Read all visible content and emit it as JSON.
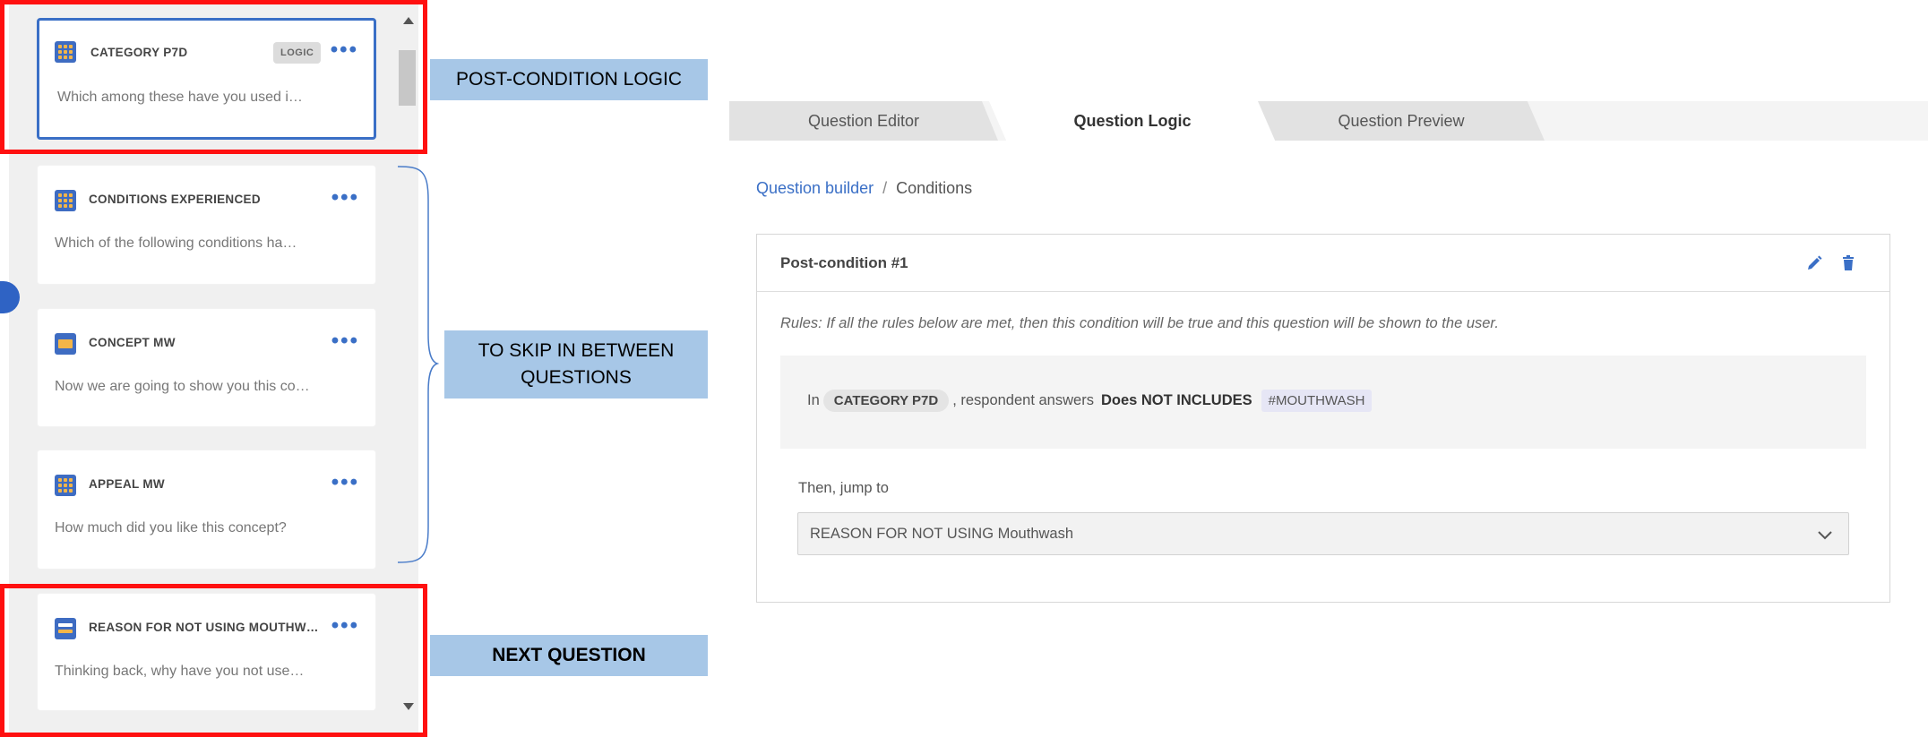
{
  "questions": [
    {
      "title": "CATEGORY P7D",
      "badge": "LOGIC",
      "text": "Which among these have you used i…",
      "icon": "grid-question-icon",
      "selected": true
    },
    {
      "title": "CONDITIONS EXPERIENCED",
      "text": "Which of the following conditions ha…",
      "icon": "grid-question-icon"
    },
    {
      "title": "CONCEPT MW",
      "text": "Now we are going to show you this co…",
      "icon": "media-question-icon"
    },
    {
      "title": "APPEAL MW",
      "text": "How much did you like this concept?",
      "icon": "grid-question-icon"
    },
    {
      "title": "REASON FOR NOT USING MOUTHW…",
      "text": "Thinking back, why have you not use…",
      "icon": "text-question-icon"
    }
  ],
  "more_symbol": "•••",
  "annotations": {
    "post_condition": "POST-CONDITION LOGIC",
    "skip_line1": "TO SKIP IN BETWEEN",
    "skip_line2": "QUESTIONS",
    "next_question": "NEXT QUESTION"
  },
  "tabs": [
    "Question Editor",
    "Question Logic",
    "Question Preview"
  ],
  "active_tab": "Question Logic",
  "breadcrumb": {
    "link": "Question builder",
    "separator": "/",
    "current": "Conditions"
  },
  "condition": {
    "title": "Post-condition #1",
    "rules_text": "Rules: If all the rules below are met, then this condition will be true and this question will be shown to the user.",
    "rule": {
      "prefix": "In",
      "question": "CATEGORY P7D",
      "middle": ", respondent answers",
      "operator": "Does NOT INCLUDES",
      "value": "#MOUTHWASH"
    },
    "then_label": "Then, jump to",
    "jump_target": "REASON FOR NOT USING Mouthwash"
  },
  "colors": {
    "accent": "#3a6fc6",
    "annotation_red": "#ff1010",
    "label_blue": "#a7c7e7",
    "icon_yellow": "#f3b548"
  }
}
